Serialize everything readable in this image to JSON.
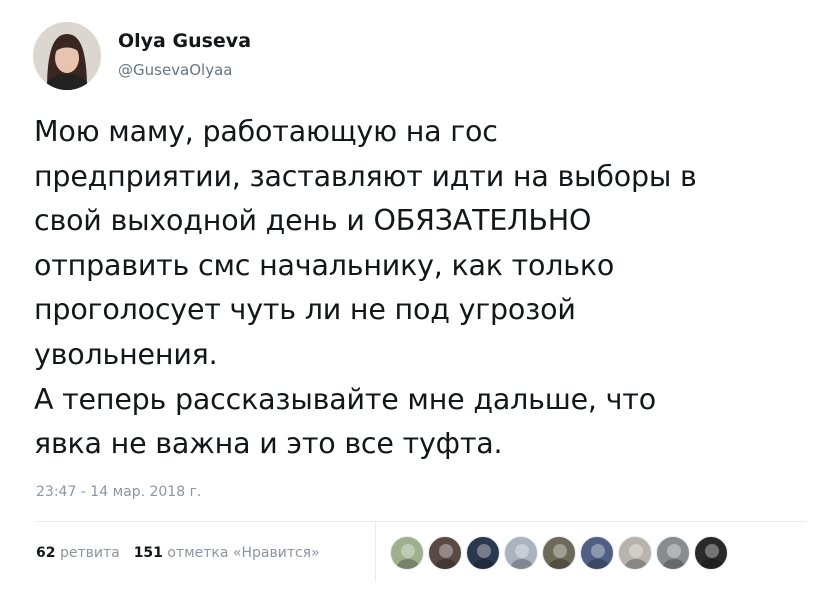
{
  "author": {
    "name": "Olya Guseva",
    "handle": "@GusevaOlyaa"
  },
  "tweet": {
    "text": "Мою маму, работающую на гос\nпредприятии, заставляют идти на выборы в\nсвой выходной день и ОБЯЗАТЕЛЬНО\nотправить смс начальнику, как только\nпроголосует чуть ли не под угрозой\nувольнения.\nА теперь рассказывайте мне дальше, что\nявка не важна и это все туфта.",
    "timestamp": "23:47 - 14 мар. 2018 г."
  },
  "stats": {
    "retweets_count": "62",
    "retweets_label": "ретвита",
    "likes_count": "151",
    "likes_label": "отметка «Нравится»"
  },
  "likers": [
    {
      "name": "liker-1",
      "color": "#9fb08e"
    },
    {
      "name": "liker-2",
      "color": "#5b4a44"
    },
    {
      "name": "liker-3",
      "color": "#2c3850"
    },
    {
      "name": "liker-4",
      "color": "#aab4c0"
    },
    {
      "name": "liker-5",
      "color": "#6e6a58"
    },
    {
      "name": "liker-6",
      "color": "#4f5f85"
    },
    {
      "name": "liker-7",
      "color": "#b8b3ad"
    },
    {
      "name": "liker-8",
      "color": "#8a8d90"
    },
    {
      "name": "liker-9",
      "color": "#2a2a2a"
    }
  ]
}
